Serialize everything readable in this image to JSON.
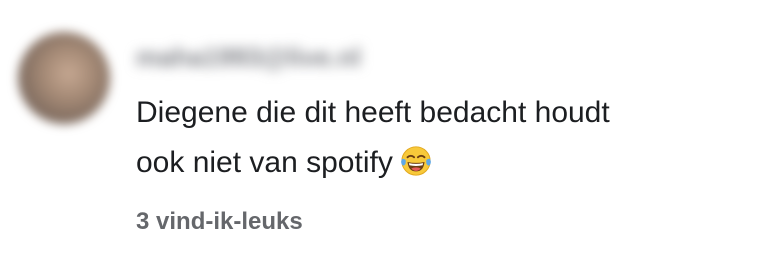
{
  "comment": {
    "author": "maha1993@live.nl",
    "text_line1": "Diegene die dit heeft bedacht houdt",
    "text_line2": "ook niet van spotify",
    "emoji_icon": "face-with-tears-of-joy-icon",
    "likes_label": "3 vind-ik-leuks"
  },
  "colors": {
    "text": "#1c1e21",
    "secondary": "#65676b",
    "background": "#ffffff"
  }
}
